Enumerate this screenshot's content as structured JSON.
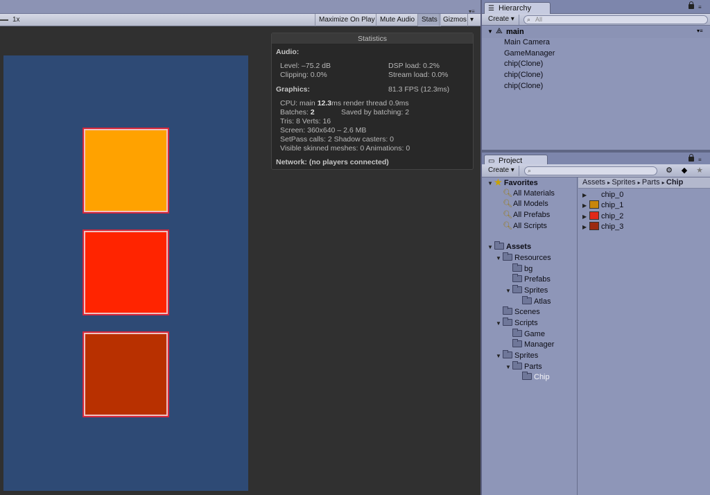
{
  "game": {
    "scale_label": "1x",
    "toolbar": {
      "maximize_on_play": "Maximize On Play",
      "mute_audio": "Mute Audio",
      "stats": "Stats",
      "gizmos": "Gizmos"
    },
    "chips": [
      {
        "name": "chip_1",
        "color": "#ffa200"
      },
      {
        "name": "chip_2",
        "color": "#ff2400"
      },
      {
        "name": "chip_3",
        "color": "#b83000"
      }
    ]
  },
  "stats": {
    "title": "Statistics",
    "audio_header": "Audio:",
    "level": "Level: –75.2 dB",
    "clipping": "Clipping: 0.0%",
    "dsp_load": "DSP load: 0.2%",
    "stream_load": "Stream load: 0.0%",
    "graphics_header": "Graphics:",
    "fps": "81.3 FPS (12.3ms)",
    "cpu_prefix": "CPU: main ",
    "cpu_main": "12.3",
    "cpu_suffix": "ms  render thread 0.9ms",
    "batches_prefix": "Batches: ",
    "batches": "2",
    "saved_by_batching": "Saved by batching: 2",
    "tris_verts": "Tris: 8   Verts: 16",
    "screen": "Screen: 360x640 – 2.6 MB",
    "setpass": "SetPass calls: 2   Shadow casters: 0",
    "skinned": "Visible skinned meshes: 0  Animations: 0",
    "network": "Network: (no players connected)"
  },
  "hierarchy": {
    "tab_label": "Hierarchy",
    "create_label": "Create",
    "search_placeholder": "All",
    "scene_name": "main",
    "items": [
      "Main Camera",
      "GameManager",
      "chip(Clone)",
      "chip(Clone)",
      "chip(Clone)"
    ]
  },
  "project": {
    "tab_label": "Project",
    "create_label": "Create",
    "favorites_label": "Favorites",
    "favorites": [
      "All Materials",
      "All Models",
      "All Prefabs",
      "All Scripts"
    ],
    "assets_label": "Assets",
    "tree": {
      "resources": "Resources",
      "bg": "bg",
      "prefabs": "Prefabs",
      "sprites_res": "Sprites",
      "atlas": "Atlas",
      "scenes": "Scenes",
      "scripts": "Scripts",
      "game": "Game",
      "manager": "Manager",
      "sprites": "Sprites",
      "parts": "Parts",
      "chip": "Chip"
    },
    "breadcrumb": {
      "assets": "Assets",
      "sprites": "Sprites",
      "parts": "Parts",
      "chip": "Chip"
    },
    "files": [
      {
        "name": "chip_0",
        "color": ""
      },
      {
        "name": "chip_1",
        "color": "#c8860c"
      },
      {
        "name": "chip_2",
        "color": "#e0281a"
      },
      {
        "name": "chip_3",
        "color": "#9c2a10"
      }
    ]
  }
}
